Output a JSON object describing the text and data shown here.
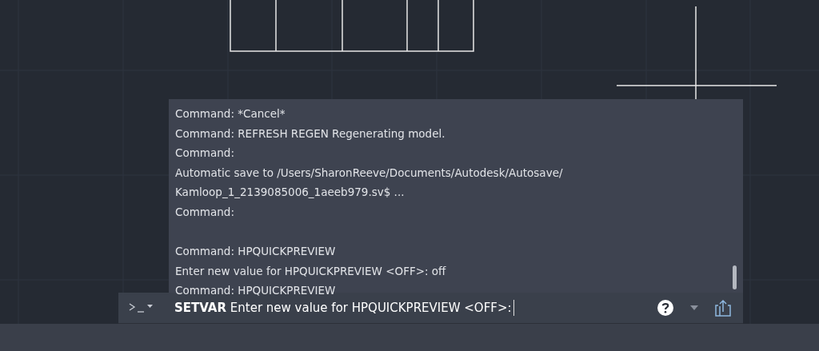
{
  "command_history": {
    "lines": [
      {
        "kind": "text",
        "text": "Command: *Cancel*"
      },
      {
        "kind": "text",
        "text": "Command: REFRESH REGEN Regenerating model."
      },
      {
        "kind": "text",
        "text": "Command:"
      },
      {
        "kind": "text",
        "text": "Automatic save to /Users/SharonReeve/Documents/Autodesk/Autosave/"
      },
      {
        "kind": "text",
        "text": "Kamloop_1_2139085006_1aeeb979.sv$ ..."
      },
      {
        "kind": "text",
        "text": "Command:"
      },
      {
        "kind": "blank"
      },
      {
        "kind": "text",
        "text": "Command: HPQUICKPREVIEW"
      },
      {
        "kind": "text",
        "text": "Enter new value for HPQUICKPREVIEW <OFF>: off"
      },
      {
        "kind": "text",
        "text": "Command: HPQUICKPREVIEW"
      }
    ]
  },
  "command_line": {
    "prompt": "**SETVAR** Enter new value for HPQUICKPREVIEW <OFF>:"
  }
}
